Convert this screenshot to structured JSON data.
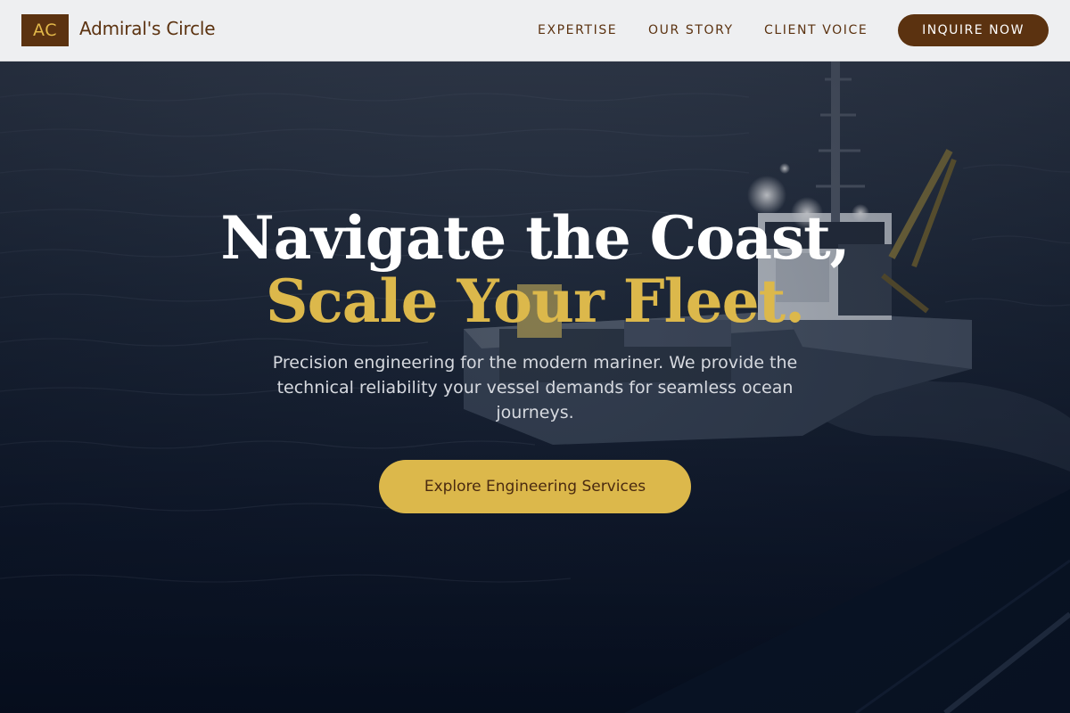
{
  "brand": {
    "badge": "AC",
    "name": "Admiral's Circle",
    "badge_color": "#5b3210",
    "accent_color": "#dcb84b"
  },
  "nav": {
    "links": [
      {
        "label": "EXPERTISE"
      },
      {
        "label": "OUR STORY"
      },
      {
        "label": "CLIENT VOICE"
      }
    ],
    "cta_label": "INQUIRE NOW"
  },
  "hero": {
    "headline_line1": "Navigate the Coast,",
    "headline_line2": "Scale Your Fleet.",
    "subtext": "Precision engineering for the modern mariner. We provide the technical reliability your vessel demands for seamless ocean journeys.",
    "cta_label": "Explore Engineering Services",
    "background_image": "ship-at-sea-photo"
  }
}
